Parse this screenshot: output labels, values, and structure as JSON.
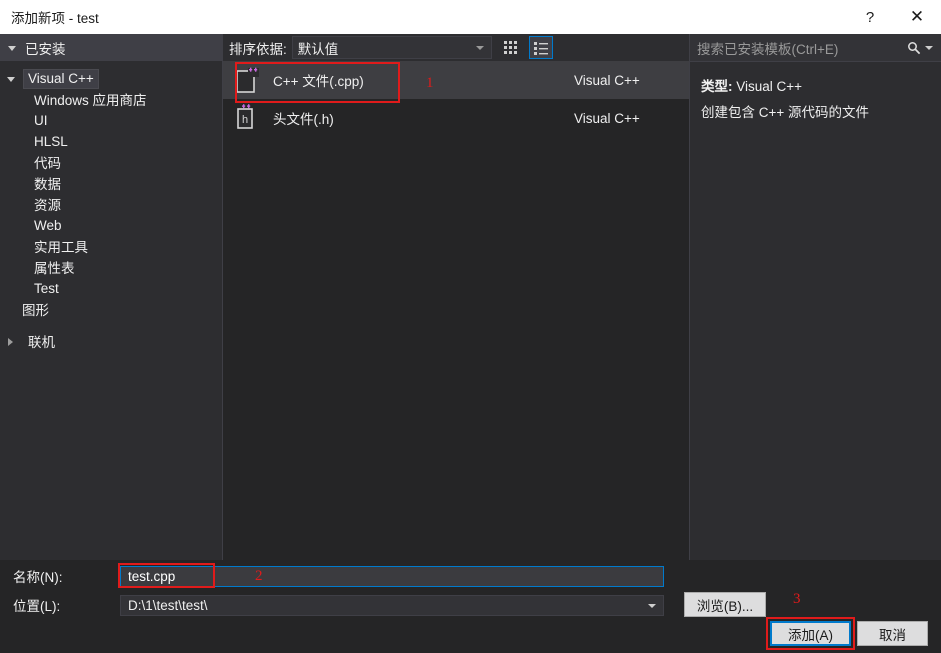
{
  "titlebar": {
    "title": "添加新项 - test",
    "help_label": "?",
    "close_label": "✕"
  },
  "sidebar": {
    "header": "已安装",
    "items": [
      {
        "label": "Visual C++",
        "level": 1,
        "expanded": true,
        "selected": true
      },
      {
        "label": "Windows 应用商店",
        "level": 2,
        "selected": false
      },
      {
        "label": "UI",
        "level": 2,
        "selected": false
      },
      {
        "label": "HLSL",
        "level": 2,
        "selected": false
      },
      {
        "label": "代码",
        "level": 2,
        "selected": false
      },
      {
        "label": "数据",
        "level": 2,
        "selected": false
      },
      {
        "label": "资源",
        "level": 2,
        "selected": false
      },
      {
        "label": "Web",
        "level": 2,
        "selected": false
      },
      {
        "label": "实用工具",
        "level": 2,
        "selected": false
      },
      {
        "label": "属性表",
        "level": 2,
        "selected": false
      },
      {
        "label": "Test",
        "level": 2,
        "selected": false
      },
      {
        "label": "图形",
        "level": 1.5,
        "selected": false
      },
      {
        "label": "联机",
        "level": 1,
        "expanded": false,
        "selected": false
      }
    ]
  },
  "center": {
    "sort_label": "排序依据:",
    "sort_value": "默认值",
    "view_grid_icon": "medium-icons-icon",
    "view_list_icon": "list-view-icon",
    "templates": [
      {
        "name": "C++ 文件(.cpp)",
        "origin": "Visual C++",
        "icon": "cpp-file-icon",
        "badge": "++",
        "glyph": "",
        "selected": true
      },
      {
        "name": "头文件(.h)",
        "origin": "Visual C++",
        "icon": "header-file-icon",
        "badge": "++",
        "glyph": "h",
        "selected": false
      }
    ]
  },
  "right": {
    "search_placeholder": "搜索已安装模板(Ctrl+E)",
    "search_icon": "search-icon",
    "detail_type_label": "类型:",
    "detail_type_value": "Visual C++",
    "detail_description": "创建包含 C++ 源代码的文件"
  },
  "form": {
    "name_label": "名称(N):",
    "name_value": "test.cpp",
    "location_label": "位置(L):",
    "location_value": "D:\\1\\test\\test\\",
    "browse_button": "浏览(B)...",
    "add_button": "添加(A)",
    "cancel_button": "取消"
  },
  "annotations": {
    "marker_1": "1",
    "marker_2": "2",
    "marker_3": "3",
    "color": "#e01b1b"
  }
}
